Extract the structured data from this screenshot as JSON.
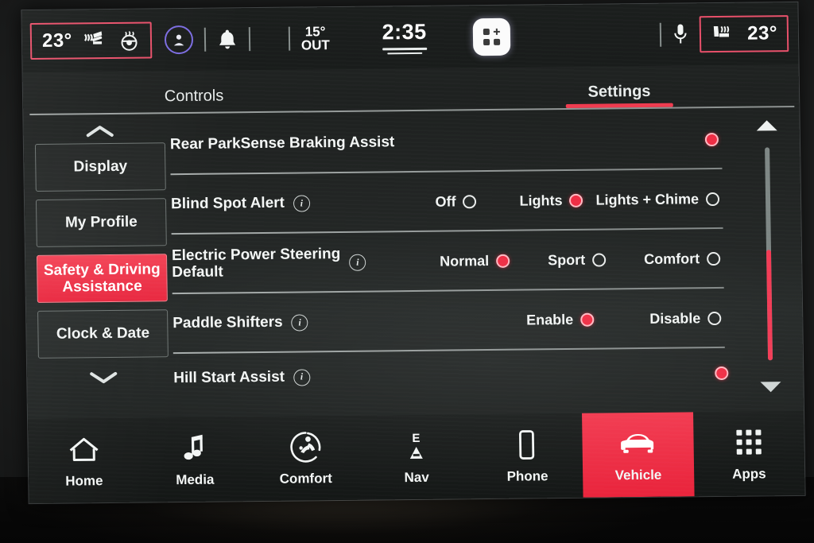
{
  "status_bar": {
    "left_climate": {
      "temperature": "23°",
      "seat_heat_icon": "heated-seat-icon",
      "steering_heat_icon": "heated-steering-wheel-icon",
      "highlight_color": "#e8506a"
    },
    "profile_icon": "driver-profile-icon",
    "notification_icon": "bell-icon",
    "outside_temp": {
      "value": "15°",
      "label": "OUT"
    },
    "clock": "2:35",
    "app_grid_icon": "app-grid-icon",
    "microphone_icon": "microphone-icon",
    "right_climate": {
      "temperature": "23°",
      "seat_heat_icon": "heated-seat-icon",
      "highlight_color": "#e8506a"
    }
  },
  "tabs": [
    {
      "label": "Controls",
      "active": false
    },
    {
      "label": "Settings",
      "active": true
    }
  ],
  "sidebar": {
    "scroll_up_icon": "chevron-up-icon",
    "scroll_down_icon": "chevron-down-icon",
    "items": [
      {
        "label": "Display",
        "active": false
      },
      {
        "label": "My Profile",
        "active": false
      },
      {
        "label": "Safety & Driving\nAssistance",
        "active": true
      },
      {
        "label": "Clock & Date",
        "active": false
      }
    ],
    "active_color": "#ef2d44"
  },
  "settings_rows": [
    {
      "label": "Rear ParkSense Braking Assist",
      "has_info": false,
      "type": "toggle",
      "options": [
        {
          "label": "",
          "selected": true
        }
      ]
    },
    {
      "label": "Blind Spot Alert",
      "has_info": true,
      "type": "radio-group",
      "options": [
        {
          "label": "Off",
          "selected": false
        },
        {
          "label": "Lights",
          "selected": true
        },
        {
          "label": "Lights + Chime",
          "selected": false
        }
      ]
    },
    {
      "label": "Electric Power Steering\nDefault",
      "has_info": true,
      "type": "radio-group",
      "options": [
        {
          "label": "Normal",
          "selected": true
        },
        {
          "label": "Sport",
          "selected": false
        },
        {
          "label": "Comfort",
          "selected": false
        }
      ]
    },
    {
      "label": "Paddle Shifters",
      "has_info": true,
      "type": "radio-group",
      "options": [
        {
          "label": "Enable",
          "selected": true
        },
        {
          "label": "Disable",
          "selected": false
        }
      ]
    },
    {
      "label": "Hill Start Assist",
      "has_info": true,
      "type": "toggle",
      "options": [
        {
          "label": "",
          "selected": true
        }
      ]
    }
  ],
  "scrollbar": {
    "up_icon": "triangle-up-icon",
    "down_icon": "triangle-down-icon",
    "thumb_fraction": 0.52,
    "thumb_color": "#f23b55"
  },
  "bottom_nav": {
    "active_color": "#ef2d44",
    "items": [
      {
        "label": "Home",
        "icon": "home-icon",
        "active": false
      },
      {
        "label": "Media",
        "icon": "music-note-icon",
        "active": false
      },
      {
        "label": "Comfort",
        "icon": "climate-seat-icon",
        "active": false
      },
      {
        "label": "Nav",
        "icon": "compass-icon",
        "active": false
      },
      {
        "label": "Phone",
        "icon": "phone-icon",
        "active": false
      },
      {
        "label": "Vehicle",
        "icon": "car-icon",
        "active": true
      },
      {
        "label": "Apps",
        "icon": "apps-grid-icon",
        "active": false
      }
    ]
  }
}
